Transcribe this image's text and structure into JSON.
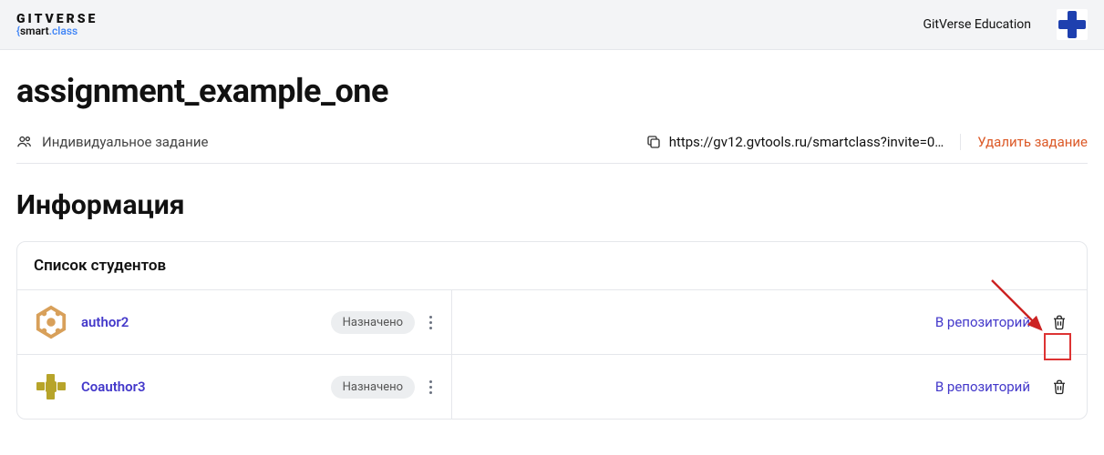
{
  "logo": {
    "top": "GITVERSE",
    "bottom_smart": "smart",
    "bottom_class": ".class"
  },
  "header": {
    "org_name": "GitVerse Education"
  },
  "page": {
    "title": "assignment_example_one"
  },
  "meta": {
    "type_label": "Индивидуальное задание",
    "invite_url": "https://gv12.gvtools.ru/smartclass?invite=0…",
    "delete_label": "Удалить задание"
  },
  "section": {
    "title": "Информация"
  },
  "list": {
    "header": "Список студентов",
    "repo_link_label": "В репозиторий",
    "students": [
      {
        "name": "author2",
        "status": "Назначено",
        "avatar": "hex"
      },
      {
        "name": "Coauthor3",
        "status": "Назначено",
        "avatar": "squares"
      }
    ]
  }
}
